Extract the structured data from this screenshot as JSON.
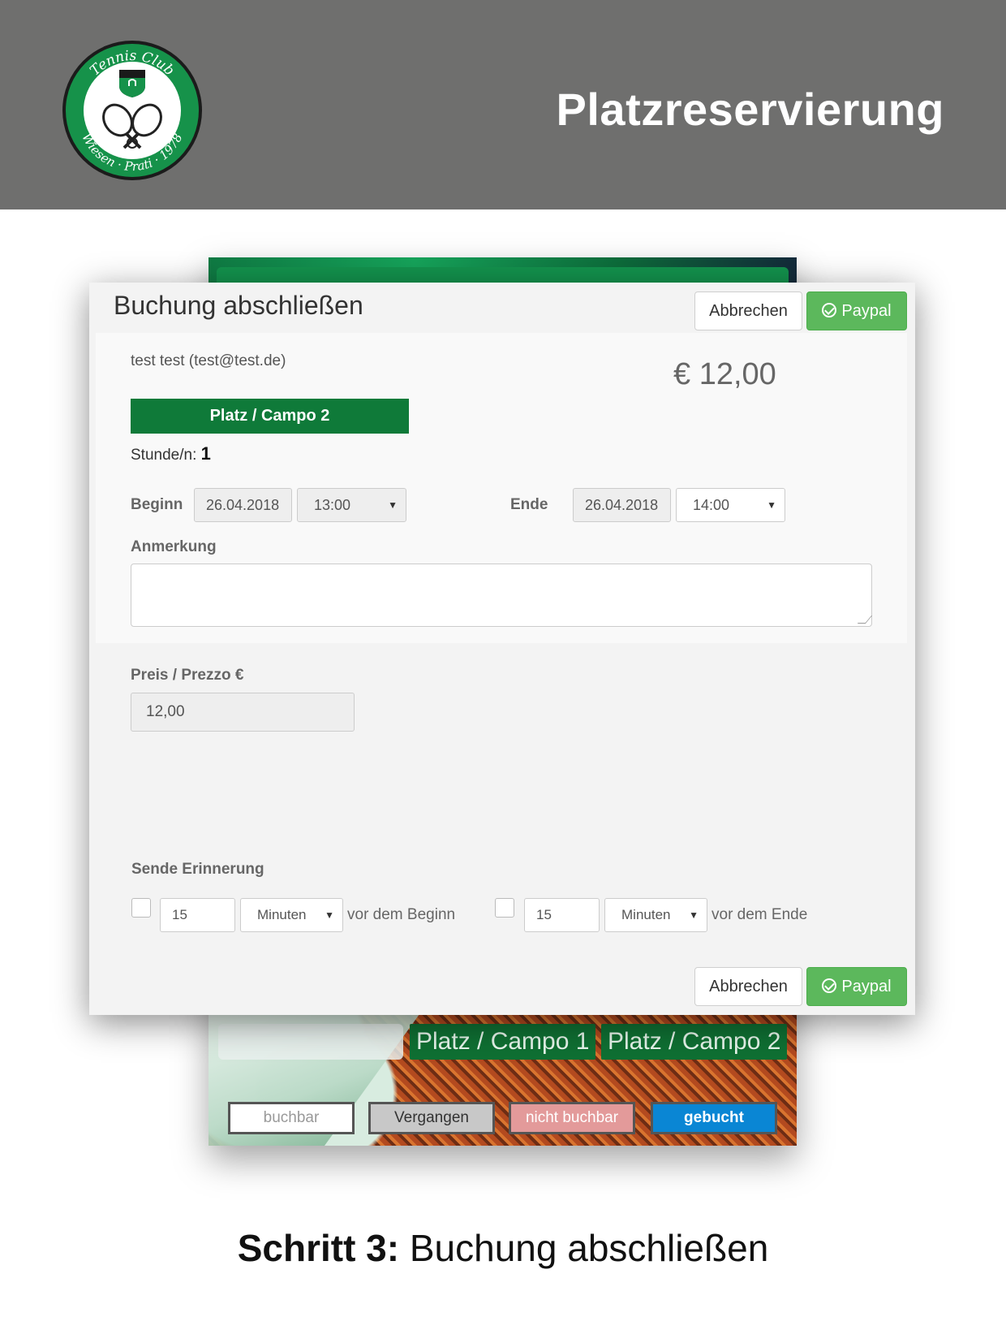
{
  "header": {
    "title": "Platzreservierung",
    "logo": {
      "top_text": "Tennis Club",
      "bottom_text": "Wiesen · Prati · 1978"
    }
  },
  "background_app": {
    "campos": [
      "Platz / Campo 1",
      "Platz / Campo 2"
    ],
    "legend": [
      {
        "label": "buchbar",
        "color": "#ffffff",
        "text_color": "#999999"
      },
      {
        "label": "Vergangen",
        "color": "#c8c8c8",
        "text_color": "#333333"
      },
      {
        "label": "nicht buchbar",
        "color": "#e39a9a",
        "text_color": "#ffffff"
      },
      {
        "label": "gebucht",
        "color": "#0a86d4",
        "text_color": "#ffffff"
      }
    ]
  },
  "modal": {
    "title": "Buchung abschließen",
    "cancel_label": "Abbrechen",
    "paypal_label": "Paypal",
    "user": "test test (test@test.de)",
    "price_display": "€ 12,00",
    "court": "Platz / Campo 2",
    "hours_label": "Stunde/n:",
    "hours_value": "1",
    "begin": {
      "label": "Beginn",
      "date": "26.04.2018",
      "time": "13:00"
    },
    "end": {
      "label": "Ende",
      "date": "26.04.2018",
      "time": "14:00"
    },
    "note_label": "Anmerkung",
    "price_label": "Preis / Prezzo €",
    "price_value": "12,00",
    "reminder": {
      "label": "Sende Erinnerung",
      "first": {
        "amount": "15",
        "unit": "Minuten",
        "suffix": "vor dem Beginn"
      },
      "second": {
        "amount": "15",
        "unit": "Minuten",
        "suffix": "vor dem Ende"
      }
    }
  },
  "caption": {
    "bold": "Schritt 3:",
    "rest": " Buchung abschließen"
  },
  "colors": {
    "header_bg": "#6f6f6e",
    "brand_green": "#0f7a39",
    "paypal_green": "#5cb85c"
  }
}
